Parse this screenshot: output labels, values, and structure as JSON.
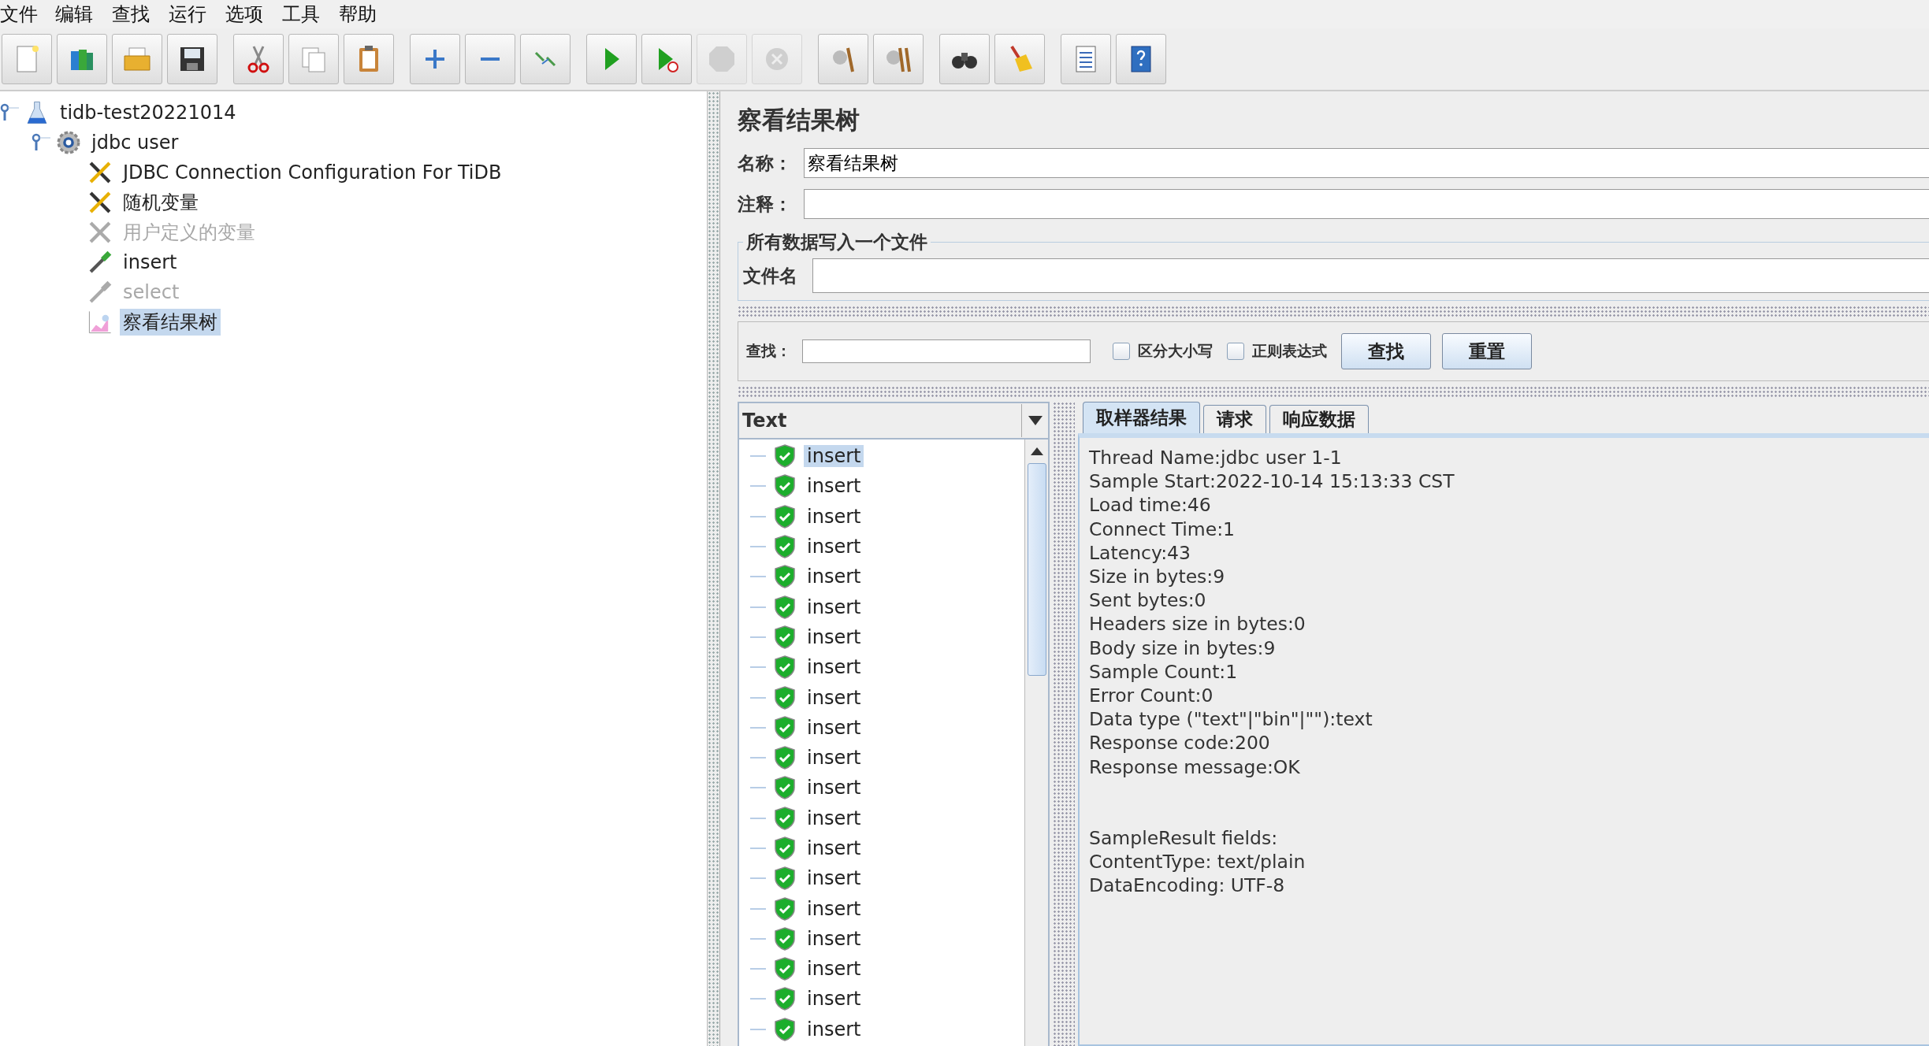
{
  "menu": [
    "文件",
    "编辑",
    "查找",
    "运行",
    "选项",
    "工具",
    "帮助"
  ],
  "toolbar": [
    [
      {
        "kind": "new",
        "disabled": false
      },
      {
        "kind": "templates",
        "disabled": false
      },
      {
        "kind": "open",
        "disabled": false
      },
      {
        "kind": "save",
        "disabled": false
      }
    ],
    [
      {
        "kind": "cut",
        "disabled": false
      },
      {
        "kind": "copy",
        "disabled": false
      },
      {
        "kind": "paste",
        "disabled": false
      }
    ],
    [
      {
        "kind": "expand",
        "disabled": false
      },
      {
        "kind": "collapse",
        "disabled": false
      },
      {
        "kind": "toggle",
        "disabled": false
      }
    ],
    [
      {
        "kind": "start",
        "disabled": false
      },
      {
        "kind": "start-no-timers",
        "disabled": false
      },
      {
        "kind": "stop",
        "disabled": true
      },
      {
        "kind": "shutdown",
        "disabled": true
      }
    ],
    [
      {
        "kind": "clear",
        "disabled": false
      },
      {
        "kind": "clear-all",
        "disabled": false
      }
    ],
    [
      {
        "kind": "search",
        "disabled": false
      },
      {
        "kind": "reset-search",
        "disabled": false
      }
    ],
    [
      {
        "kind": "function-helper",
        "disabled": false
      },
      {
        "kind": "help",
        "disabled": false
      }
    ]
  ],
  "tree": [
    {
      "label": "tidb-test20221014",
      "kind": "test-plan",
      "expanded": true,
      "disabled": false,
      "selected": false,
      "children": [
        {
          "label": "jdbc user",
          "kind": "thread-group",
          "expanded": true,
          "disabled": false,
          "selected": false,
          "children": [
            {
              "label": "JDBC Connection Configuration For TiDB",
              "kind": "config",
              "disabled": false,
              "selected": false
            },
            {
              "label": "随机变量",
              "kind": "config",
              "disabled": false,
              "selected": false
            },
            {
              "label": "用户定义的变量",
              "kind": "config",
              "disabled": true,
              "selected": false
            },
            {
              "label": "insert",
              "kind": "sampler",
              "disabled": false,
              "selected": false
            },
            {
              "label": "select",
              "kind": "sampler",
              "disabled": true,
              "selected": false
            },
            {
              "label": "察看结果树",
              "kind": "listener",
              "disabled": false,
              "selected": true
            }
          ]
        }
      ]
    }
  ],
  "panel": {
    "title": "察看结果树",
    "name_label": "名称：",
    "name_value": "察看结果树",
    "comment_label": "注释：",
    "file_group": {
      "legend": "所有数据写入一个文件",
      "label": "文件名"
    },
    "search": {
      "label": "查找：",
      "options": [
        {
          "label": "区分大小写",
          "checked": false
        },
        {
          "label": "正则表达式",
          "checked": false
        }
      ],
      "buttons": [
        "查找",
        "重置"
      ]
    },
    "renderer": "Text",
    "results": [
      {
        "label": "insert",
        "kind": "success",
        "selected": true
      },
      {
        "label": "insert",
        "kind": "success",
        "selected": false
      },
      {
        "label": "insert",
        "kind": "success",
        "selected": false
      },
      {
        "label": "insert",
        "kind": "success",
        "selected": false
      },
      {
        "label": "insert",
        "kind": "success",
        "selected": false
      },
      {
        "label": "insert",
        "kind": "success",
        "selected": false
      },
      {
        "label": "insert",
        "kind": "success",
        "selected": false
      },
      {
        "label": "insert",
        "kind": "success",
        "selected": false
      },
      {
        "label": "insert",
        "kind": "success",
        "selected": false
      },
      {
        "label": "insert",
        "kind": "success",
        "selected": false
      },
      {
        "label": "insert",
        "kind": "success",
        "selected": false
      },
      {
        "label": "insert",
        "kind": "success",
        "selected": false
      },
      {
        "label": "insert",
        "kind": "success",
        "selected": false
      },
      {
        "label": "insert",
        "kind": "success",
        "selected": false
      },
      {
        "label": "insert",
        "kind": "success",
        "selected": false
      },
      {
        "label": "insert",
        "kind": "success",
        "selected": false
      },
      {
        "label": "insert",
        "kind": "success",
        "selected": false
      },
      {
        "label": "insert",
        "kind": "success",
        "selected": false
      },
      {
        "label": "insert",
        "kind": "success",
        "selected": false
      },
      {
        "label": "insert",
        "kind": "success",
        "selected": false
      }
    ],
    "tabs": [
      {
        "label": "取样器结果",
        "selected": true
      },
      {
        "label": "请求",
        "selected": false
      },
      {
        "label": "响应数据",
        "selected": false
      }
    ],
    "sampler_result": [
      [
        "Thread Name:jdbc user 1-1",
        "Sample Start:2022-10-14 15:13:33 CST",
        "Load time:46",
        "Connect Time:1",
        "Latency:43",
        "Size in bytes:9",
        "Sent bytes:0",
        "Headers size in bytes:0",
        "Body size in bytes:9",
        "Sample Count:1",
        "Error Count:0",
        "Data type (\"text\"|\"bin\"|\"\"):text",
        "Response code:200",
        "Response message:OK"
      ],
      [
        "SampleResult fields:",
        "ContentType: text/plain",
        "DataEncoding: UTF-8"
      ]
    ]
  }
}
